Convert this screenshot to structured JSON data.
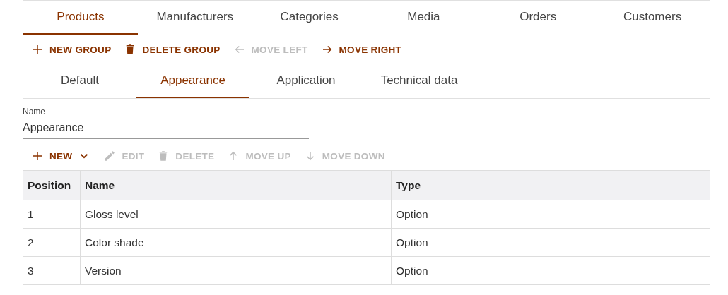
{
  "main_tabs": [
    {
      "label": "Products",
      "selected": true
    },
    {
      "label": "Manufacturers",
      "selected": false
    },
    {
      "label": "Categories",
      "selected": false
    },
    {
      "label": "Media",
      "selected": false
    },
    {
      "label": "Orders",
      "selected": false
    },
    {
      "label": "Customers",
      "selected": false
    }
  ],
  "group_toolbar": [
    {
      "label": "NEW GROUP",
      "kind": "plus",
      "disabled": false
    },
    {
      "label": "DELETE GROUP",
      "kind": "trash",
      "disabled": false
    },
    {
      "label": "MOVE LEFT",
      "kind": "left",
      "disabled": true
    },
    {
      "label": "MOVE RIGHT",
      "kind": "right",
      "disabled": false
    }
  ],
  "group_tabs": [
    {
      "label": "Default",
      "selected": false
    },
    {
      "label": "Appearance",
      "selected": true
    },
    {
      "label": "Application",
      "selected": false
    },
    {
      "label": "Technical data",
      "selected": false
    }
  ],
  "name_field": {
    "label": "Name",
    "value": "Appearance"
  },
  "item_toolbar": [
    {
      "label": "NEW",
      "kind": "plus",
      "disabled": false,
      "dropdown": true
    },
    {
      "label": "EDIT",
      "kind": "pencil",
      "disabled": true
    },
    {
      "label": "DELETE",
      "kind": "trash",
      "disabled": true
    },
    {
      "label": "MOVE UP",
      "kind": "up",
      "disabled": true
    },
    {
      "label": "MOVE DOWN",
      "kind": "down",
      "disabled": true
    }
  ],
  "table": {
    "columns": [
      "Position",
      "Name",
      "Type"
    ],
    "rows": [
      [
        "1",
        "Gloss level",
        "Option"
      ],
      [
        "2",
        "Color shade",
        "Option"
      ],
      [
        "3",
        "Version",
        "Option"
      ]
    ]
  }
}
